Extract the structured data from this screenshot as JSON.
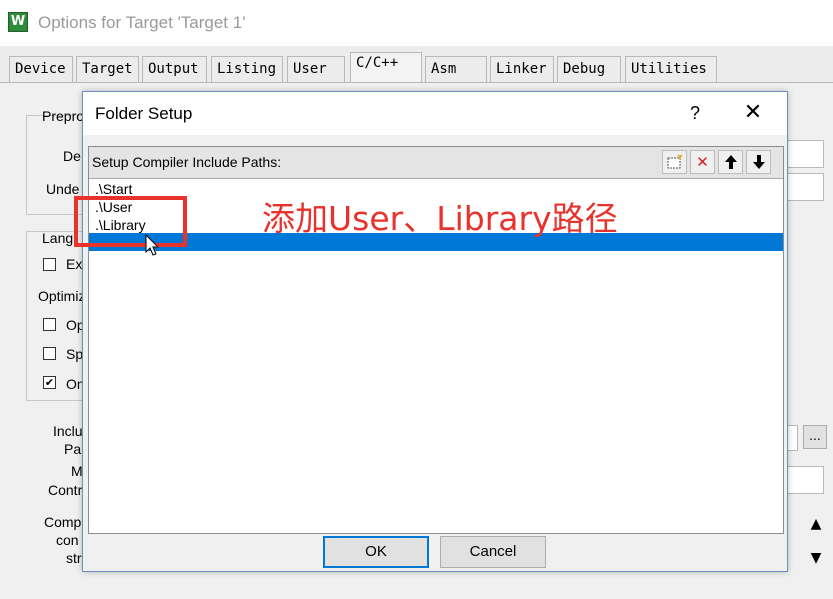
{
  "window": {
    "title": "Options for Target 'Target 1'",
    "icon_glyph": "W"
  },
  "tabs": [
    {
      "label": "Device"
    },
    {
      "label": "Target"
    },
    {
      "label": "Output"
    },
    {
      "label": "Listing"
    },
    {
      "label": "User"
    },
    {
      "label": "C/C++"
    },
    {
      "label": "Asm"
    },
    {
      "label": "Linker"
    },
    {
      "label": "Debug"
    },
    {
      "label": "Utilities"
    }
  ],
  "active_tab": "C/C++",
  "background": {
    "preproc_label": "Prepro",
    "define_label": "De",
    "undefine_label": "Unde",
    "language_label": "Lang",
    "ex_label": "Ex",
    "optimize_label": "Optimiz",
    "op_label": "Op",
    "sp_label": "Sp",
    "on_label": "On",
    "include_label_1": "Inclu",
    "include_label_2": "Pa",
    "misc_label_1": "M",
    "misc_label_2": "Contr",
    "compiler_label_1": "Comp",
    "compiler_label_2": "con",
    "compiler_label_3": "str",
    "check_mark": "✔",
    "ellipsis_button": "..."
  },
  "dialog": {
    "title": "Folder Setup",
    "help": "?",
    "close": "✕",
    "list_header": "Setup Compiler Include Paths:",
    "toolbar": {
      "new_icon": "☐",
      "delete_icon": "✕",
      "up_icon": "🡅",
      "down_icon": "🡇"
    },
    "paths": [
      ".\\Start",
      ".\\User",
      ".\\Library"
    ],
    "ok_label": "OK",
    "cancel_label": "Cancel"
  },
  "annotation": {
    "text": "添加User、Library路径",
    "color": "#e8322b"
  },
  "colors": {
    "selection": "#0078d7",
    "dialog_border": "#6a8fc2"
  }
}
